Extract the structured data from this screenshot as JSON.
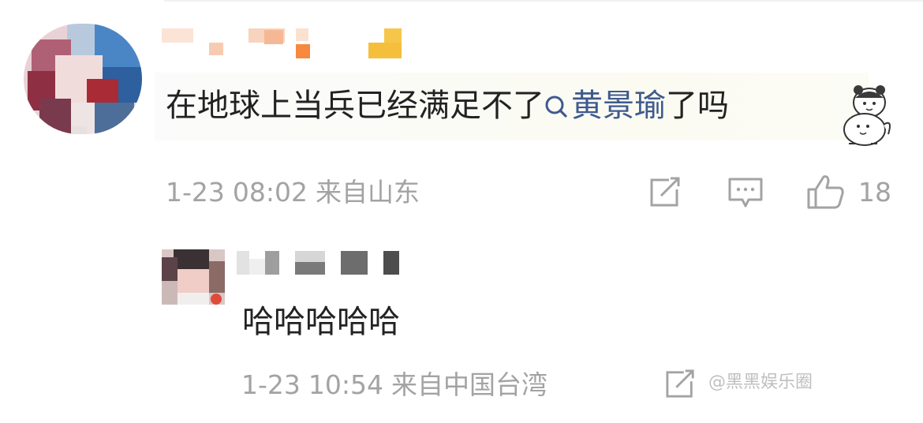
{
  "comment": {
    "author_display": "",
    "text": "在地球上当兵已经满足不了",
    "topic_link": "黄景瑜",
    "text_after": "了吗",
    "date": "1-23",
    "time": "08:02",
    "location": "来自山东",
    "like_count": "18",
    "icons": [
      "share-icon",
      "comment-icon",
      "like-icon",
      "search-icon"
    ]
  },
  "reply": {
    "text": "哈哈哈哈哈",
    "date": "1-23",
    "time": "10:54",
    "location": "来自中国台湾",
    "icons": [
      "share-icon"
    ]
  },
  "watermark": {
    "text": "@黑黑娱乐圈"
  },
  "colors": {
    "link": "#3e5a8e",
    "meta": "#a3a3a3",
    "text": "#222222",
    "background": "#ffffff"
  }
}
